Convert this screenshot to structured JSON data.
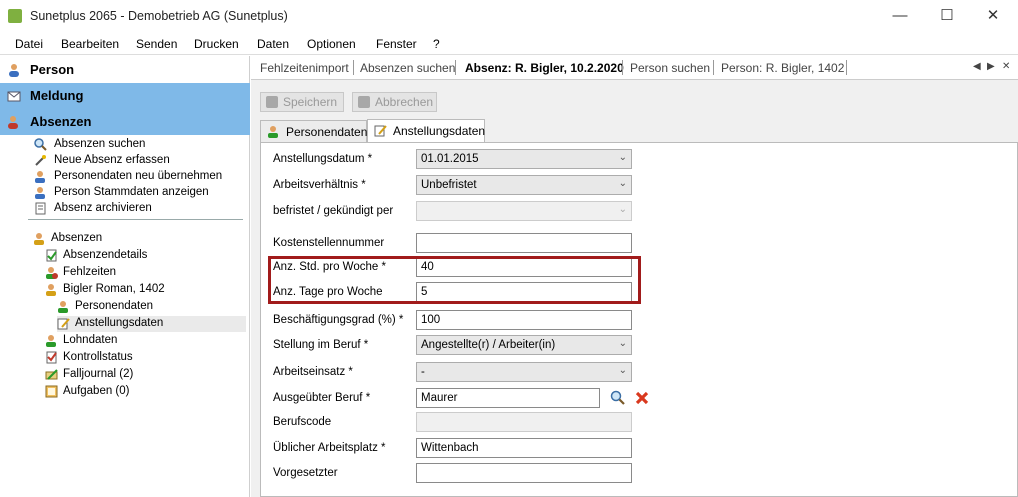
{
  "window": {
    "title": "Sunetplus 2065 - Demobetrieb AG (Sunetplus)",
    "minimize": "—",
    "maximize": "☐",
    "close": "✕"
  },
  "menu": [
    "Datei",
    "Bearbeiten",
    "Senden",
    "Drucken",
    "Daten",
    "Optionen",
    "Fenster",
    "?"
  ],
  "sidebar": {
    "categories": [
      {
        "label": "Person",
        "icon": "person-icon"
      },
      {
        "label": "Meldung",
        "icon": "envelope-icon"
      },
      {
        "label": "Absenzen",
        "icon": "absence-icon"
      }
    ],
    "actions": [
      {
        "label": "Absenzen suchen",
        "icon": "search-icon"
      },
      {
        "label": "Neue Absenz erfassen",
        "icon": "wand-icon"
      },
      {
        "label": "Personendaten neu übernehmen",
        "icon": "person-refresh-icon"
      },
      {
        "label": "Person Stammdaten anzeigen",
        "icon": "person-icon"
      },
      {
        "label": "Absenz archivieren",
        "icon": "archive-icon"
      }
    ],
    "tree": [
      {
        "label": "Absenzen",
        "icon": "absence-group-icon"
      },
      {
        "label": "Absenzendetails",
        "icon": "check-doc-icon"
      },
      {
        "label": "Fehlzeiten",
        "icon": "missing-time-icon"
      },
      {
        "label": "Bigler Roman, 1402",
        "icon": "person-icon"
      },
      {
        "label": "Personendaten",
        "icon": "person-check-icon"
      },
      {
        "label": "Anstellungsdaten",
        "icon": "edit-doc-icon"
      },
      {
        "label": "Lohndaten",
        "icon": "wage-icon"
      },
      {
        "label": "Kontrollstatus",
        "icon": "checklist-icon"
      },
      {
        "label": "Falljournal (2)",
        "icon": "journal-icon"
      },
      {
        "label": "Aufgaben (0)",
        "icon": "tasks-icon"
      }
    ]
  },
  "doc_tabs": [
    {
      "label": "Fehlzeitenimport"
    },
    {
      "label": "Absenzen suchen"
    },
    {
      "label": "Absenz: R. Bigler, 10.2.2020"
    },
    {
      "label": "Person suchen"
    },
    {
      "label": "Person: R. Bigler, 1402"
    }
  ],
  "nav": {
    "prev": "◀",
    "next": "▶",
    "close": "✕"
  },
  "toolbar": {
    "save": "Speichern",
    "cancel": "Abbrechen"
  },
  "sub_tabs": [
    {
      "label": "Personendaten"
    },
    {
      "label": "Anstellungsdaten"
    }
  ],
  "form": {
    "anstellungsdatum": {
      "label": "Anstellungsdatum *",
      "value": "01.01.2015"
    },
    "arbeitsverhaeltnis": {
      "label": "Arbeitsverhältnis *",
      "value": "Unbefristet"
    },
    "befristet": {
      "label": "befristet / gekündigt per",
      "value": ""
    },
    "kostenstelle": {
      "label": "Kostenstellennummer",
      "value": ""
    },
    "std_pro_woche": {
      "label": "Anz. Std. pro Woche *",
      "value": "40"
    },
    "tage_pro_woche": {
      "label": "Anz. Tage pro Woche",
      "value": "5"
    },
    "beschaeftigungsgrad": {
      "label": "Beschäftigungsgrad (%) *",
      "value": "100"
    },
    "stellung": {
      "label": "Stellung im Beruf *",
      "value": "Angestellte(r) / Arbeiter(in)"
    },
    "arbeitseinsatz": {
      "label": "Arbeitseinsatz *",
      "value": "-"
    },
    "beruf": {
      "label": "Ausgeübter Beruf *",
      "value": "Maurer"
    },
    "berufscode": {
      "label": "Berufscode",
      "value": ""
    },
    "arbeitsplatz": {
      "label": "Üblicher Arbeitsplatz *",
      "value": "Wittenbach"
    },
    "vorgesetzter": {
      "label": "Vorgesetzter",
      "value": ""
    }
  },
  "colors": {
    "selected_category": "#7fb9e8",
    "highlight_border": "#a11b1b"
  }
}
